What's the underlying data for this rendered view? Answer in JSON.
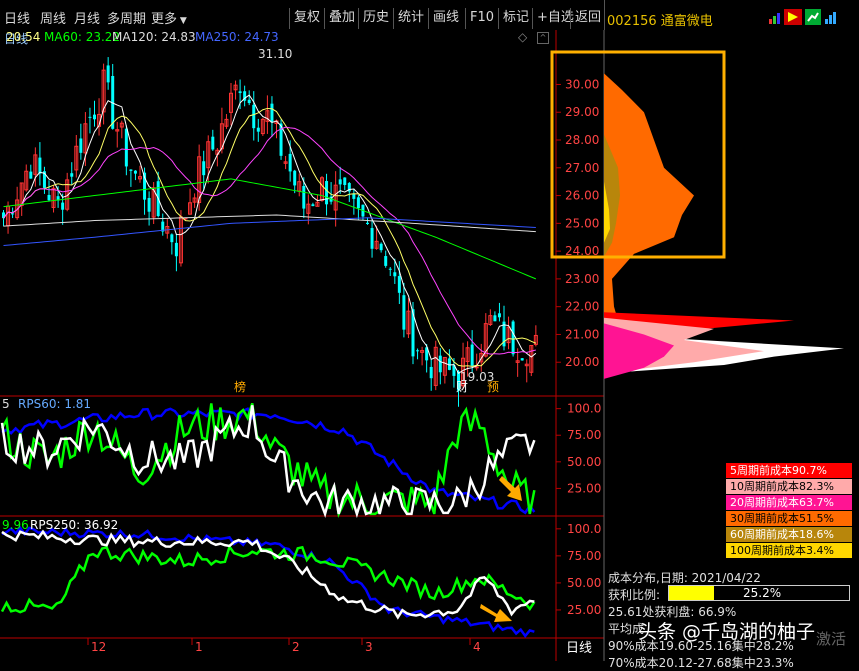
{
  "toolbar": {
    "period_daily": "日线",
    "period_weekly": "周线",
    "period_monthly": "月线",
    "period_multi": "多周期",
    "more": "更多",
    "btn_restore": "复权",
    "btn_overlay": "叠加",
    "btn_history": "历史",
    "btn_stats": "统计",
    "btn_draw": "画线",
    "btn_f10": "F10",
    "btn_mark": "标记",
    "btn_add_watch": "+自选",
    "btn_back": "返回"
  },
  "stock": {
    "code": "002156",
    "name": "通富微电"
  },
  "indicators": {
    "ma_main": "日线",
    "ma1": "20.54",
    "ma60": "MA60: 23.22",
    "ma120": "MA120: 24.83",
    "ma250": "MA250: 24.73"
  },
  "price_chart": {
    "high_label": "31.10",
    "low_label": "19.03",
    "markers": [
      "榜",
      "财",
      "预"
    ],
    "yticks": [
      "30.00",
      "29.00",
      "28.00",
      "27.00",
      "26.00",
      "25.00",
      "24.00",
      "23.00",
      "22.00",
      "21.00",
      "20.00"
    ]
  },
  "rps1": {
    "left_label": "5",
    "title": "RPS60: 1.81",
    "yticks": [
      "100.0",
      "75.00",
      "50.00",
      "25.00"
    ]
  },
  "rps2": {
    "left_label": "9.96",
    "title": "RPS250: 36.92",
    "yticks": [
      "100.0",
      "75.00",
      "50.00",
      "25.00"
    ]
  },
  "x_axis": {
    "labels": [
      "12",
      "1",
      "2",
      "3",
      "4"
    ],
    "period_tag": "日线"
  },
  "cost_legend": [
    {
      "label": "5周期前成本90.7%",
      "bg": "#ff0000",
      "fg": "#ffffff"
    },
    {
      "label": "10周期前成本82.3%",
      "bg": "#ffaaaa",
      "fg": "#000000"
    },
    {
      "label": "20周期前成本63.7%",
      "bg": "#ff1493",
      "fg": "#ffffff"
    },
    {
      "label": "30周期前成本51.5%",
      "bg": "#ff6a00",
      "fg": "#000000"
    },
    {
      "label": "60周期前成本18.6%",
      "bg": "#b8860b",
      "fg": "#ffffff"
    },
    {
      "label": "100周期前成本3.4%",
      "bg": "#ffd700",
      "fg": "#000000"
    }
  ],
  "cost_info": {
    "date_line": "成本分布,日期:  2021/04/22",
    "profit_label": "获利比例:",
    "profit_value": "25.2%",
    "profit_pct": 0.252,
    "line3": "25.61处获利盘:  66.9%",
    "line4": "平均成",
    "line5": "90%成本19.60-25.16集中28.2%",
    "line6": "70%成本20.12-27.68集中23.3%"
  },
  "watermark": "头条 @千岛湖的柚子",
  "activate": "激活",
  "colors": {
    "accent_yellow": "#e8c000",
    "up": "#ff3333",
    "down": "#00ffff",
    "box": "#ffb000"
  }
}
